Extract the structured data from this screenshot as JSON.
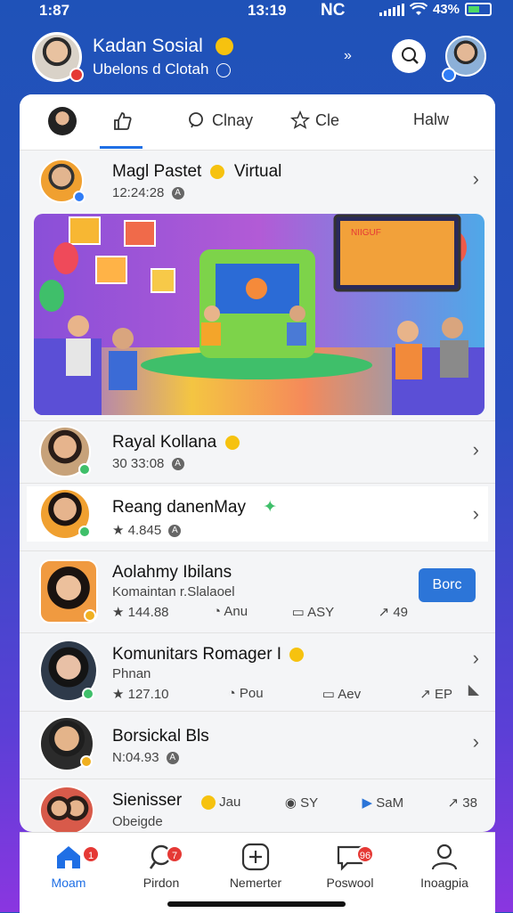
{
  "status": {
    "time_left": "1:87",
    "time_center": "13:19",
    "carrier": "NC",
    "battery": "43%"
  },
  "header": {
    "title": "Kadan Sosial",
    "subtitle": "Ubelons d Clotah",
    "share_glyph": "»"
  },
  "tabs": [
    {
      "label": "",
      "icon": "like-icon"
    },
    {
      "label": "Clnay",
      "icon": "search-icon"
    },
    {
      "label": "Cle",
      "icon": "star-icon"
    },
    {
      "label": "Halw",
      "icon": ""
    }
  ],
  "rows": [
    {
      "title": "Magl Pastet",
      "title_tag": "Virtual",
      "meta": "12:24:28"
    },
    {
      "title": "Rayal Kollana",
      "meta": "30 33:08"
    },
    {
      "title": "Reang danenMay",
      "meta": "4.845"
    },
    {
      "title": "Aolahmy Ibilans",
      "meta": "Komaintan r.Slalaoel",
      "stats": [
        "144.88",
        "Anu",
        "ASY",
        "49"
      ],
      "button": "Borc"
    },
    {
      "title": "Komunitars Romager I",
      "meta": "Phnan",
      "stats": [
        "127.10",
        "Pou",
        "Aev",
        "EP"
      ]
    },
    {
      "title": "Borsickal Bls",
      "meta": "N:04.93"
    },
    {
      "title": "Sienisser",
      "meta": "Obeigde",
      "stats": [
        "Jau",
        "SY",
        "SaM",
        "38"
      ]
    }
  ],
  "hero": {
    "screen_text": "NIIGUF"
  },
  "nav": [
    {
      "label": "Moam",
      "badge": "1"
    },
    {
      "label": "Pirdon",
      "badge": "7"
    },
    {
      "label": "Nemerter",
      "badge": ""
    },
    {
      "label": "Poswool",
      "badge": "96"
    },
    {
      "label": "Inoagpia",
      "badge": ""
    }
  ],
  "colors": {
    "accent": "#1f6fe5",
    "header_bg": "#1f52b8",
    "badge_red": "#e53935",
    "button_blue": "#2c75d8"
  }
}
